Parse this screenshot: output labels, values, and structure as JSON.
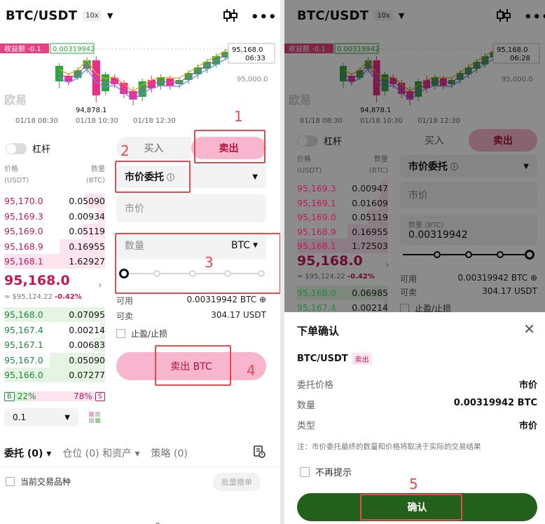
{
  "left": {
    "pair": "BTC/USDT",
    "leverage_badge": "10x",
    "chart": {
      "pnl_label": "收益额 -0.1",
      "qty_label": "0.00319942",
      "price_tag": "95,168.0",
      "countdown": "06:33",
      "level_label": "95,000.0",
      "low_label": "94,878.1",
      "watermark": "欧易",
      "times": [
        "01/18 08:30",
        "01/18 10:30",
        "01/18 12:30"
      ]
    },
    "margin_label": "杠杆",
    "orderbook": {
      "price_header": "价格",
      "price_unit": "(USDT)",
      "qty_header": "数量",
      "qty_unit": "(BTC)",
      "asks": [
        {
          "price": "95,170.0",
          "qty": "0.05090",
          "depth": 0.2
        },
        {
          "price": "95,169.3",
          "qty": "0.00934",
          "depth": 0.08
        },
        {
          "price": "95,169.0",
          "qty": "0.05119",
          "depth": 0.22
        },
        {
          "price": "95,168.9",
          "qty": "0.16955",
          "depth": 0.45
        },
        {
          "price": "95,168.1",
          "qty": "1.62927",
          "depth": 1.0
        }
      ],
      "last_price": "95,168.0",
      "last_usd": "≈ $95,124.22",
      "last_change": "-0.42%",
      "bids": [
        {
          "price": "95,168.0",
          "qty": "0.07095",
          "depth": 1.0
        },
        {
          "price": "95,167.4",
          "qty": "0.00214",
          "depth": 0.05
        },
        {
          "price": "95,167.1",
          "qty": "0.00683",
          "depth": 0.12
        },
        {
          "price": "95,167.0",
          "qty": "0.05090",
          "depth": 0.55
        },
        {
          "price": "95,166.0",
          "qty": "0.07277",
          "depth": 1.0
        }
      ],
      "buy_ratio": "22%",
      "sell_ratio": "78%",
      "buy_tag": "B",
      "sell_tag": "S",
      "precision": "0.1"
    },
    "form": {
      "buy_tab": "买入",
      "sell_tab": "卖出",
      "order_type": "市价委托",
      "price_placeholder": "市价",
      "qty_placeholder": "数量",
      "qty_unit": "BTC",
      "available_label": "可用",
      "available_value": "0.00319942 BTC",
      "sellable_label": "可卖",
      "sellable_value": "304.17 USDT",
      "tp_sl_label": "止盈/止损",
      "submit": "卖出 BTC"
    },
    "bottom": {
      "tab_orders": "委托 (0)",
      "tab_positions": "仓位 (0) 和资产",
      "tab_strategy": "策略 (0)",
      "current_pair_only": "当前交易品种",
      "batch_cancel": "批量撤单"
    },
    "annotations": [
      "1",
      "2",
      "3",
      "4"
    ]
  },
  "right": {
    "pair": "BTC/USDT",
    "leverage_badge": "10x",
    "chart": {
      "pnl_label": "收益额 -0.1",
      "qty_label": "0.00319942",
      "price_tag": "95,168.0",
      "countdown": "06:28",
      "level_label": "95,000.0",
      "low_label": "94,878.1",
      "watermark": "欧易",
      "times": [
        "01/18 08:30",
        "01/18 10:30",
        "01/18 12:30"
      ]
    },
    "margin_label": "杠杆",
    "orderbook": {
      "price_header": "价格",
      "price_unit": "(USDT)",
      "qty_header": "数量",
      "qty_unit": "(BTC)",
      "asks": [
        {
          "price": "95,169.3",
          "qty": "0.00947",
          "depth": 0.08
        },
        {
          "price": "95,169.1",
          "qty": "0.01609",
          "depth": 0.1
        },
        {
          "price": "95,169.0",
          "qty": "0.05119",
          "depth": 0.22
        },
        {
          "price": "95,168.9",
          "qty": "0.16955",
          "depth": 0.45
        },
        {
          "price": "95,168.1",
          "qty": "1.72503",
          "depth": 1.0
        }
      ],
      "last_price": "95,168.0",
      "last_usd": "≈ $95,124.22",
      "last_change": "-0.42%",
      "bids": [
        {
          "price": "95,168.0",
          "qty": "0.06985",
          "depth": 1.0
        },
        {
          "price": "95,167.4",
          "qty": "0.00214",
          "depth": 0.05
        }
      ]
    },
    "form": {
      "buy_tab": "买入",
      "sell_tab": "卖出",
      "order_type": "市价委托",
      "price_placeholder": "市价",
      "qty_label": "数量 (BTC)",
      "qty_value": "0.00319942",
      "available_label": "可用",
      "available_value": "0.00319942 BTC",
      "sellable_label": "可卖",
      "sellable_value": "304.17 USDT",
      "tp_sl_label": "止盈/止损"
    },
    "dialog": {
      "title": "下单确认",
      "pair": "BTC/USDT",
      "side": "卖出",
      "rows": [
        {
          "label": "委托价格",
          "value": "市价"
        },
        {
          "label": "数量",
          "value": "0.00319942 BTC"
        },
        {
          "label": "类型",
          "value": "市价"
        }
      ],
      "note": "注：市价委托最终的数量和价格将取决于实际的交易结果",
      "dont_show": "不再提示",
      "confirm": "确认"
    },
    "annotations": [
      "5"
    ]
  }
}
